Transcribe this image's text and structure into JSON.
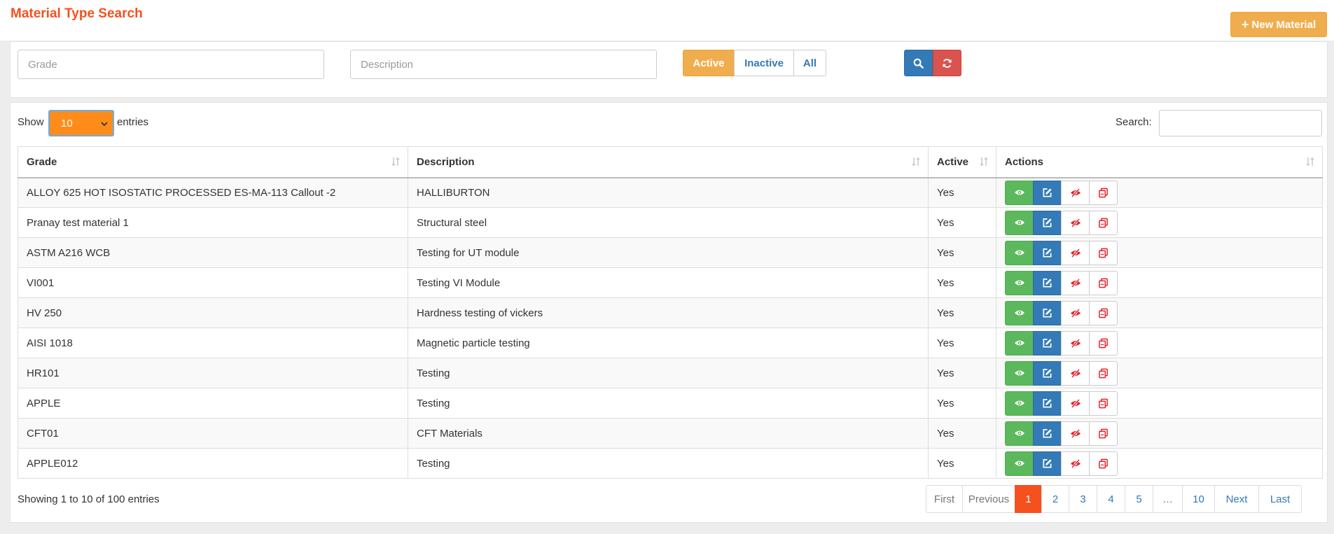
{
  "page": {
    "title": "Material Type Search",
    "new_button_label": "New Material"
  },
  "filters": {
    "grade_placeholder": "Grade",
    "description_placeholder": "Description",
    "status_options": [
      "Active",
      "Inactive",
      "All"
    ],
    "selected_status": "Active"
  },
  "table_controls": {
    "show_label": "Show",
    "page_length": "10",
    "entries_label": "entries",
    "search_label": "Search:"
  },
  "table": {
    "columns": [
      "Grade",
      "Description",
      "Active",
      "Actions"
    ],
    "rows": [
      {
        "grade": "ALLOY 625 HOT ISOSTATIC PROCESSED ES-MA-113 Callout -2",
        "description": "HALLIBURTON",
        "active": "Yes"
      },
      {
        "grade": "Pranay test material 1",
        "description": "Structural steel",
        "active": "Yes"
      },
      {
        "grade": "ASTM A216 WCB",
        "description": "Testing for UT module",
        "active": "Yes"
      },
      {
        "grade": "VI001",
        "description": "Testing VI Module",
        "active": "Yes"
      },
      {
        "grade": "HV 250",
        "description": "Hardness testing of vickers",
        "active": "Yes"
      },
      {
        "grade": "AISI 1018",
        "description": "Magnetic particle testing",
        "active": "Yes"
      },
      {
        "grade": "HR101",
        "description": "Testing",
        "active": "Yes"
      },
      {
        "grade": "APPLE",
        "description": "Testing",
        "active": "Yes"
      },
      {
        "grade": "CFT01",
        "description": "CFT Materials",
        "active": "Yes"
      },
      {
        "grade": "APPLE012",
        "description": "Testing",
        "active": "Yes"
      }
    ]
  },
  "footer": {
    "info": "Showing 1 to 10 of 100 entries"
  },
  "pagination": {
    "first": "First",
    "previous": "Previous",
    "pages": [
      "1",
      "2",
      "3",
      "4",
      "5",
      "…",
      "10"
    ],
    "current": "1",
    "next": "Next",
    "last": "Last"
  },
  "colors": {
    "accent": "#f4511e",
    "warning": "#f0ad4e",
    "primary": "#337ab7",
    "success": "#5cb85c",
    "danger": "#d9534f",
    "select_bg": "#ff8c1a"
  },
  "icons": {
    "new_button": "plus-icon",
    "search_button": "search-icon",
    "reset_button": "refresh-icon",
    "select": "chevron-down-icon",
    "sort": "sort-icon",
    "row_actions": [
      "eye-icon",
      "edit-icon",
      "eye-slash-icon",
      "copy-icon"
    ]
  }
}
